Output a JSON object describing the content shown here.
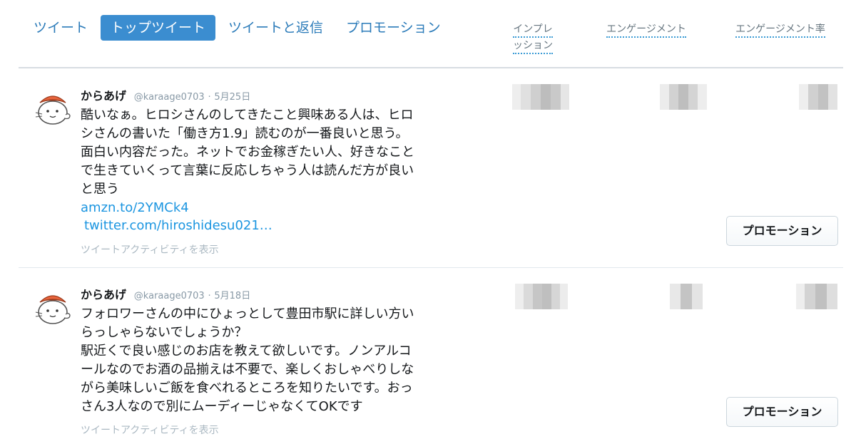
{
  "tabs": [
    {
      "label": "ツイート",
      "active": false
    },
    {
      "label": "トップツイート",
      "active": true
    },
    {
      "label": "ツイートと返信",
      "active": false
    },
    {
      "label": "プロモーション",
      "active": false
    }
  ],
  "columns": {
    "impressions": "インプレッション",
    "engagements": "エンゲージメント",
    "engagement_rate": "エンゲージメント率"
  },
  "tweets": [
    {
      "name": "からあげ",
      "handle": "@karaage0703",
      "separator": "·",
      "date": "5月25日",
      "text": "酷いなぁ。ヒロシさんのしてきたこと興味ある人は、ヒロ\nシさんの書いた「働き方1.9」読むのが一番良いと思う。\n面白い内容だった。ネットでお金稼ぎたい人、好きなこと\nで生きていくって言葉に反応しちゃう人は読んだ方が良い\nと思う",
      "link1": "amzn.to/2YMCk4",
      "link2": "twitter.com/hiroshidesu021…",
      "activity": "ツイートアクティビティを表示",
      "promo_label": "プロモーション"
    },
    {
      "name": "からあげ",
      "handle": "@karaage0703",
      "separator": "·",
      "date": "5月18日",
      "text": "フォロワーさんの中にひょっとして豊田市駅に詳しい方い\nらっしゃらないでしょうか？\n駅近くで良い感じのお店を教えて欲しいです。ノンアルコ\nールなのでお酒の品揃えは不要で、楽しくおしゃべりしな\nがら美味しいご飯を食べれるところを知りたいです。おっ\nさん3人なので別にムーディーじゃなくてOKです",
      "activity": "ツイートアクティビティを表示",
      "promo_label": "プロモーション"
    }
  ],
  "colors": {
    "accent": "#3b8dd0",
    "link": "#1b95e0",
    "tab_text": "#2b7bb9",
    "muted": "#8899a6",
    "avatar_hat": "#e8643c"
  },
  "icons": {
    "avatar": "cat-with-hat-avatar"
  }
}
